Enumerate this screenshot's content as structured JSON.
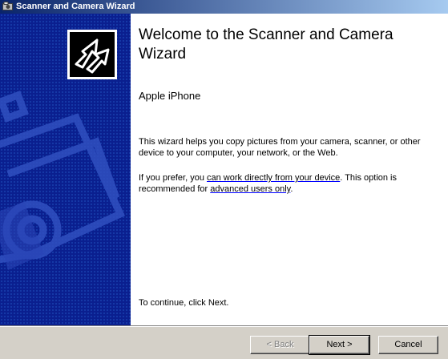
{
  "window": {
    "title": "Scanner and Camera Wizard"
  },
  "welcome": {
    "title": "Welcome to the Scanner and Camera Wizard",
    "device_name": "Apple iPhone",
    "para1": "This wizard helps you copy pictures from your camera, scanner, or other device to your computer, your network, or the Web.",
    "para2_prefix": "If you prefer, you ",
    "para2_link1": "can work directly from your device",
    "para2_mid": ". This option is recommended for ",
    "para2_link2": "advanced users only",
    "para2_suffix": ".",
    "continue_text": "To continue, click Next."
  },
  "buttons": {
    "back_label": "< Back",
    "next_label": "Next >",
    "cancel_label": "Cancel"
  },
  "icons": {
    "title_icon": "scanner-camera-icon",
    "wizard_logo": "wizard-arrow-logo-icon",
    "side_art": "camera-illustration"
  },
  "colors": {
    "title_bar_start": "#0a246a",
    "title_bar_end": "#a6caf0",
    "side_panel": "#0a1f8f",
    "link_underline": "#0000ff"
  }
}
